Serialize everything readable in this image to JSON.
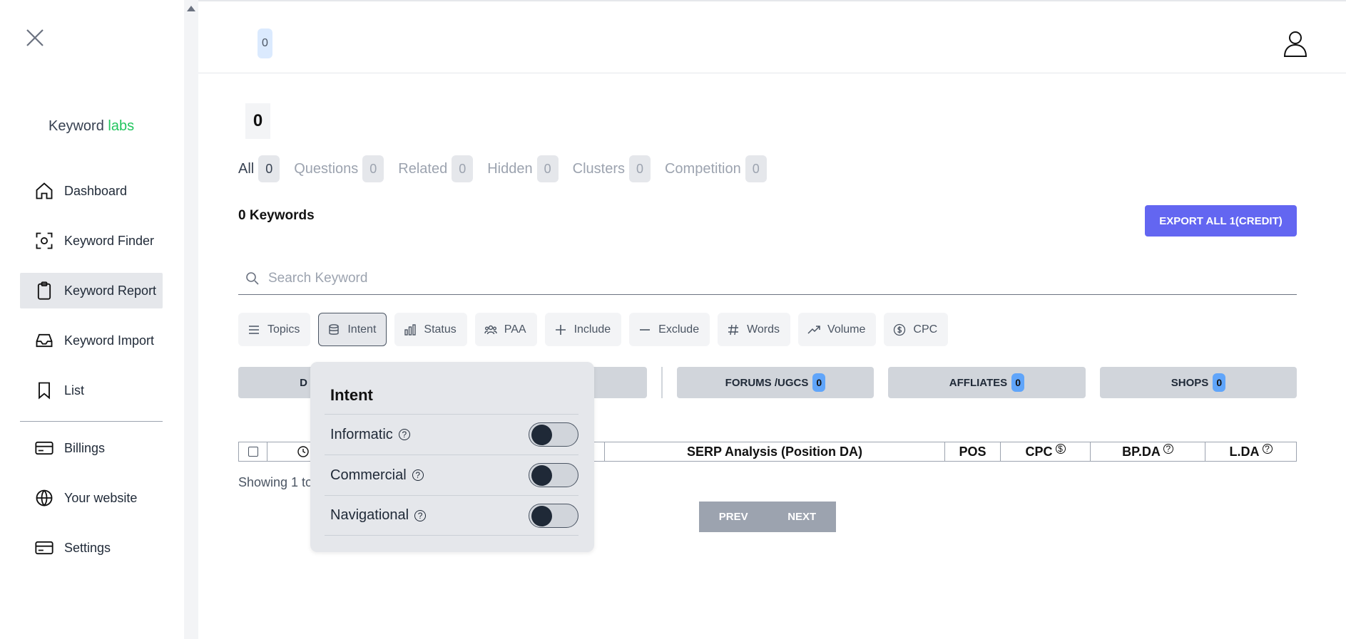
{
  "sidebar": {
    "brand_main": "Keyword",
    "brand_accent": "labs",
    "items": [
      {
        "label": "Dashboard",
        "icon": "home-icon"
      },
      {
        "label": "Keyword Finder",
        "icon": "scan-icon"
      },
      {
        "label": "Keyword Report",
        "icon": "clipboard-icon"
      },
      {
        "label": "Keyword Import",
        "icon": "inbox-icon"
      },
      {
        "label": "List",
        "icon": "bookmark-icon"
      },
      {
        "label": "Billings",
        "icon": "credit-card-icon"
      },
      {
        "label": "Your website",
        "icon": "globe-icon"
      },
      {
        "label": "Settings",
        "icon": "credit-card-icon"
      }
    ]
  },
  "topbar": {
    "badge": "0"
  },
  "main": {
    "big_count": "0",
    "tabs": [
      {
        "label": "All",
        "count": "0"
      },
      {
        "label": "Questions",
        "count": "0"
      },
      {
        "label": "Related",
        "count": "0"
      },
      {
        "label": "Hidden",
        "count": "0"
      },
      {
        "label": "Clusters",
        "count": "0"
      },
      {
        "label": "Competition",
        "count": "0"
      }
    ],
    "keywords_count": "0 Keywords",
    "export_label": "EXPORT ALL 1(CREDIT)",
    "search_placeholder": "Search Keyword",
    "filters": [
      {
        "label": "Topics",
        "icon": "menu-icon"
      },
      {
        "label": "Intent",
        "icon": "database-icon"
      },
      {
        "label": "Status",
        "icon": "bar-chart-icon"
      },
      {
        "label": "PAA",
        "icon": "users-icon"
      },
      {
        "label": "Include",
        "icon": "plus-icon"
      },
      {
        "label": "Exclude",
        "icon": "minus-icon"
      },
      {
        "label": "Words",
        "icon": "hash-icon"
      },
      {
        "label": "Volume",
        "icon": "trending-up-icon"
      },
      {
        "label": "CPC",
        "icon": "dollar-icon"
      }
    ],
    "categories": {
      "first_label_partial": "D",
      "forums": {
        "label": "FORUMS /UGCS",
        "count": "0"
      },
      "affiliates": {
        "label": "AFFLIATES",
        "count": "0"
      },
      "shops": {
        "label": "SHOPS",
        "count": "0"
      }
    },
    "table_headers": {
      "serp": "SERP Analysis (Position DA)",
      "pos": "POS",
      "cpc": "CPC",
      "bpda": "BP.DA",
      "lda": "L.DA"
    },
    "showing_partial": "Showing 1 to",
    "pager": {
      "prev": "PREV",
      "next": "NEXT"
    }
  },
  "intent_popover": {
    "title": "Intent",
    "options": [
      {
        "label": "Informatic",
        "enabled": false
      },
      {
        "label": "Commercial",
        "enabled": false
      },
      {
        "label": "Navigational",
        "enabled": false
      }
    ]
  },
  "colors": {
    "accent": "#6366f1",
    "brand_accent": "#22c55e",
    "badge": "#60a5fa"
  }
}
